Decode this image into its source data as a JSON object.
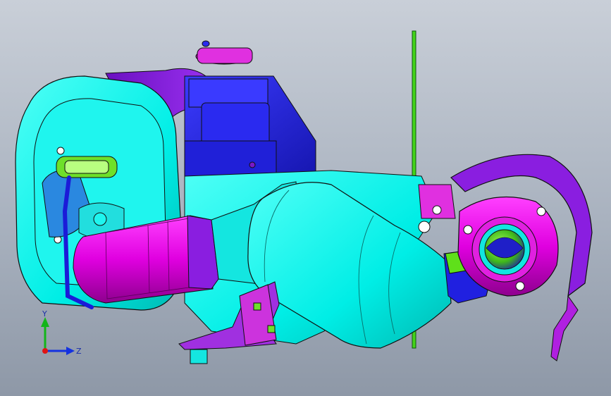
{
  "viewport": {
    "background_top": "#c9cfd8",
    "background_bottom": "#8e98a7"
  },
  "model": {
    "colors": {
      "cyan": "#00f0e8",
      "cyan_dark": "#00b6b0",
      "magenta": "#e000e0",
      "magenta_dark": "#9c009c",
      "purple": "#8a1ee0",
      "blue": "#2222ee",
      "blue_dark": "#1010a8",
      "green": "#5fd21a",
      "edge": "#101010"
    }
  },
  "triad": {
    "y_label": "Y",
    "z_label": "Z",
    "y_color": "#13b51a",
    "z_color": "#1432e0",
    "x_color": "#e01414"
  }
}
